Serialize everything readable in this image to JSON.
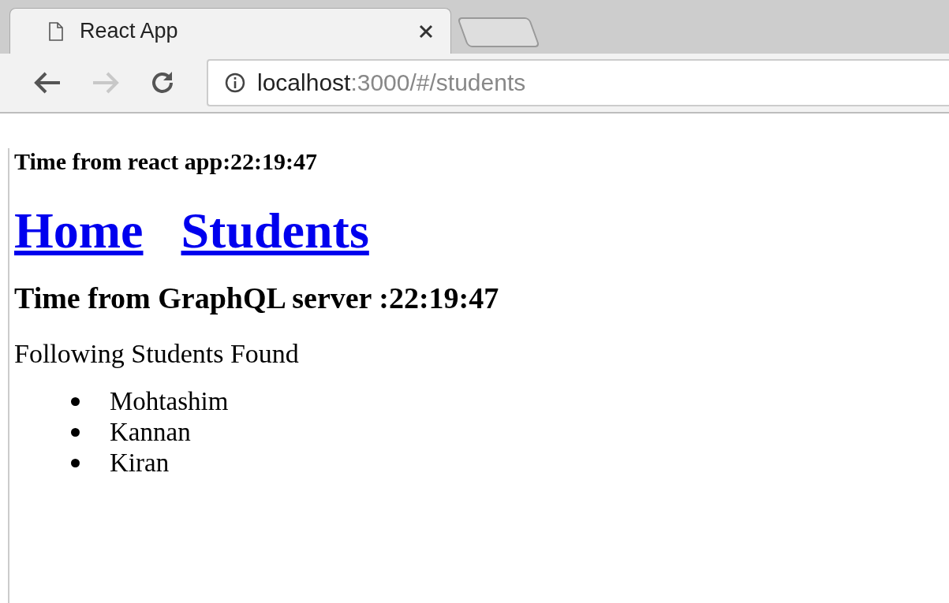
{
  "browser": {
    "tab": {
      "title": "React App"
    },
    "address": {
      "host": "localhost",
      "path": ":3000/#/students"
    }
  },
  "page": {
    "app_time": "Time from react app:22:19:47",
    "links": [
      {
        "label": "Home"
      },
      {
        "label": "Students"
      }
    ],
    "server_time": "Time from GraphQL server :22:19:47",
    "list_heading": "Following Students Found",
    "students": [
      "Mohtashim",
      "Kannan",
      "Kiran"
    ]
  }
}
